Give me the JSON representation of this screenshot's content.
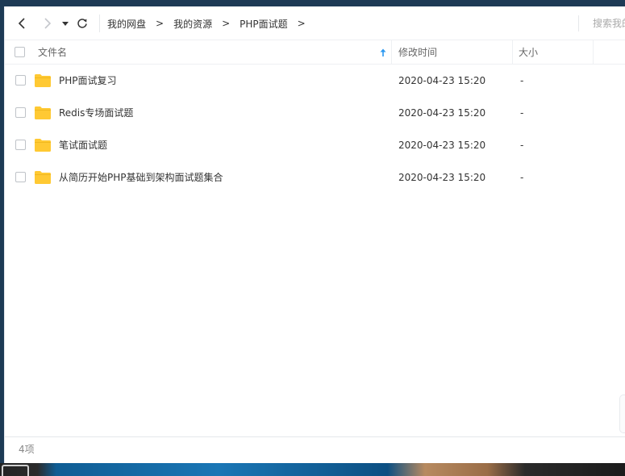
{
  "toolbar": {
    "breadcrumbs": [
      "我的网盘",
      "我的资源",
      "PHP面试题"
    ],
    "separator": ">",
    "search_placeholder": "搜索我的文件"
  },
  "columns": {
    "name": "文件名",
    "modified": "修改时间",
    "size": "大小"
  },
  "files": [
    {
      "name": "PHP面试复习",
      "modified": "2020-04-23 15:20",
      "size": "-"
    },
    {
      "name": "Redis专场面试题",
      "modified": "2020-04-23 15:20",
      "size": "-"
    },
    {
      "name": "笔试面试题",
      "modified": "2020-04-23 15:20",
      "size": "-"
    },
    {
      "name": "从简历开始PHP基础到架构面试题集合",
      "modified": "2020-04-23 15:20",
      "size": "-"
    }
  ],
  "status": {
    "item_count": "4项"
  },
  "colors": {
    "folder": "#ffc933",
    "sort_arrow": "#2b98f0",
    "wallpaper_blue": "#1a76b5"
  },
  "icons": [
    "back-icon",
    "forward-icon",
    "dropdown-icon",
    "refresh-icon",
    "sort-asc-icon",
    "folder-icon"
  ]
}
